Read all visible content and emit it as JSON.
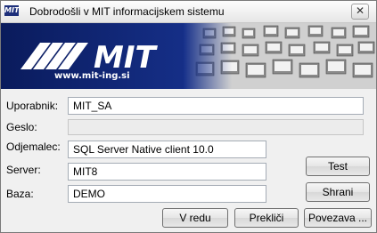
{
  "window": {
    "title_icon": "MIT",
    "title": "Dobrodošli v MIT informacijskem sistemu",
    "close_glyph": "✕"
  },
  "banner": {
    "logo_text": "MIT",
    "url": "www.mit-ing.si"
  },
  "form": {
    "user_label": "Uporabnik:",
    "user_value": "MIT_SA",
    "password_label": "Geslo:",
    "password_value": "",
    "driver_label": "Odjemalec:",
    "driver_value": "SQL Server Native client 10.0",
    "server_label": "Server:",
    "server_value": "MIT8",
    "database_label": "Baza:",
    "database_value": "DEMO"
  },
  "buttons": {
    "test": "Test",
    "save": "Shrani",
    "ok": "V redu",
    "cancel": "Prekliči",
    "connection": "Povezava ..."
  }
}
